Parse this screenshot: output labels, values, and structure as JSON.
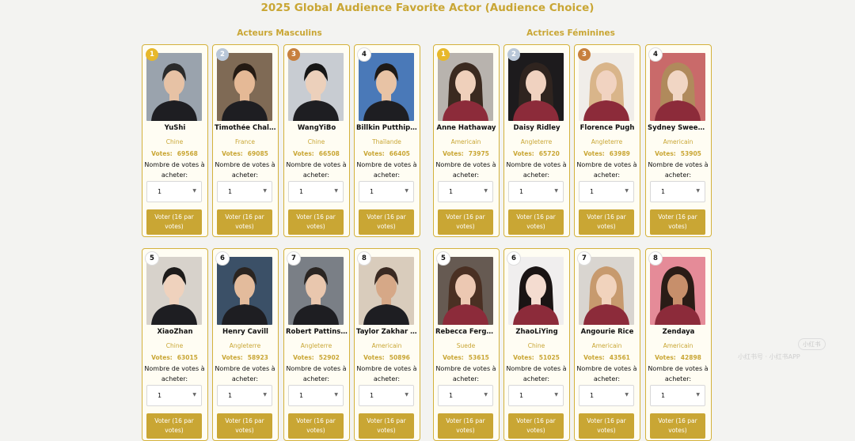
{
  "page": {
    "title": "2025 Global Audience Favorite Actor (Audience Choice)",
    "male_section": "Acteurs Masculins",
    "female_section": "Actrices Féminines"
  },
  "labels": {
    "votes": "Votes:",
    "buy": "Nombre de votes à acheter:",
    "qty": "1",
    "vote_button": "Voter (16 par votes)"
  },
  "watermark": {
    "badge": "小红书",
    "text": "小红书号 · 小红书APP"
  },
  "colors": {
    "accent": "#c9a634",
    "card_bg": "#fffdf3",
    "page_bg": "#f3f3f1"
  },
  "male": [
    {
      "rank": "1",
      "medal": "gold",
      "name": "YuShi",
      "country": "Chine",
      "votes": "69568"
    },
    {
      "rank": "2",
      "medal": "silver",
      "name": "Timothée Chalamet",
      "country": "France",
      "votes": "69085"
    },
    {
      "rank": "3",
      "medal": "bronze",
      "name": "WangYiBo",
      "country": "Chine",
      "votes": "66508"
    },
    {
      "rank": "4",
      "medal": "plain",
      "name": "Billkin Putthipong",
      "country": "Thaïlande",
      "votes": "66405"
    },
    {
      "rank": "5",
      "medal": "plain",
      "name": "XiaoZhan",
      "country": "Chine",
      "votes": "63015"
    },
    {
      "rank": "6",
      "medal": "plain",
      "name": "Henry Cavill",
      "country": "Angleterre",
      "votes": "58923"
    },
    {
      "rank": "7",
      "medal": "plain",
      "name": "Robert Pattinson",
      "country": "Angleterre",
      "votes": "52902"
    },
    {
      "rank": "8",
      "medal": "plain",
      "name": "Taylor Zakhar Perez",
      "country": "Americain",
      "votes": "50896"
    }
  ],
  "female": [
    {
      "rank": "1",
      "medal": "gold",
      "name": "Anne Hathaway",
      "country": "Americain",
      "votes": "73975"
    },
    {
      "rank": "2",
      "medal": "silver",
      "name": "Daisy Ridley",
      "country": "Angleterre",
      "votes": "65720"
    },
    {
      "rank": "3",
      "medal": "bronze",
      "name": "Florence Pugh",
      "country": "Angleterre",
      "votes": "63989"
    },
    {
      "rank": "4",
      "medal": "plain",
      "name": "Sydney Sweeney",
      "country": "Americain",
      "votes": "53905"
    },
    {
      "rank": "5",
      "medal": "plain",
      "name": "Rebecca Ferguson",
      "country": "Suede",
      "votes": "53615"
    },
    {
      "rank": "6",
      "medal": "plain",
      "name": "ZhaoLiYing",
      "country": "Chine",
      "votes": "51025"
    },
    {
      "rank": "7",
      "medal": "plain",
      "name": "Angourie Rice",
      "country": "Americain",
      "votes": "43561"
    },
    {
      "rank": "8",
      "medal": "plain",
      "name": "Zendaya",
      "country": "Americain",
      "votes": "42898"
    }
  ]
}
